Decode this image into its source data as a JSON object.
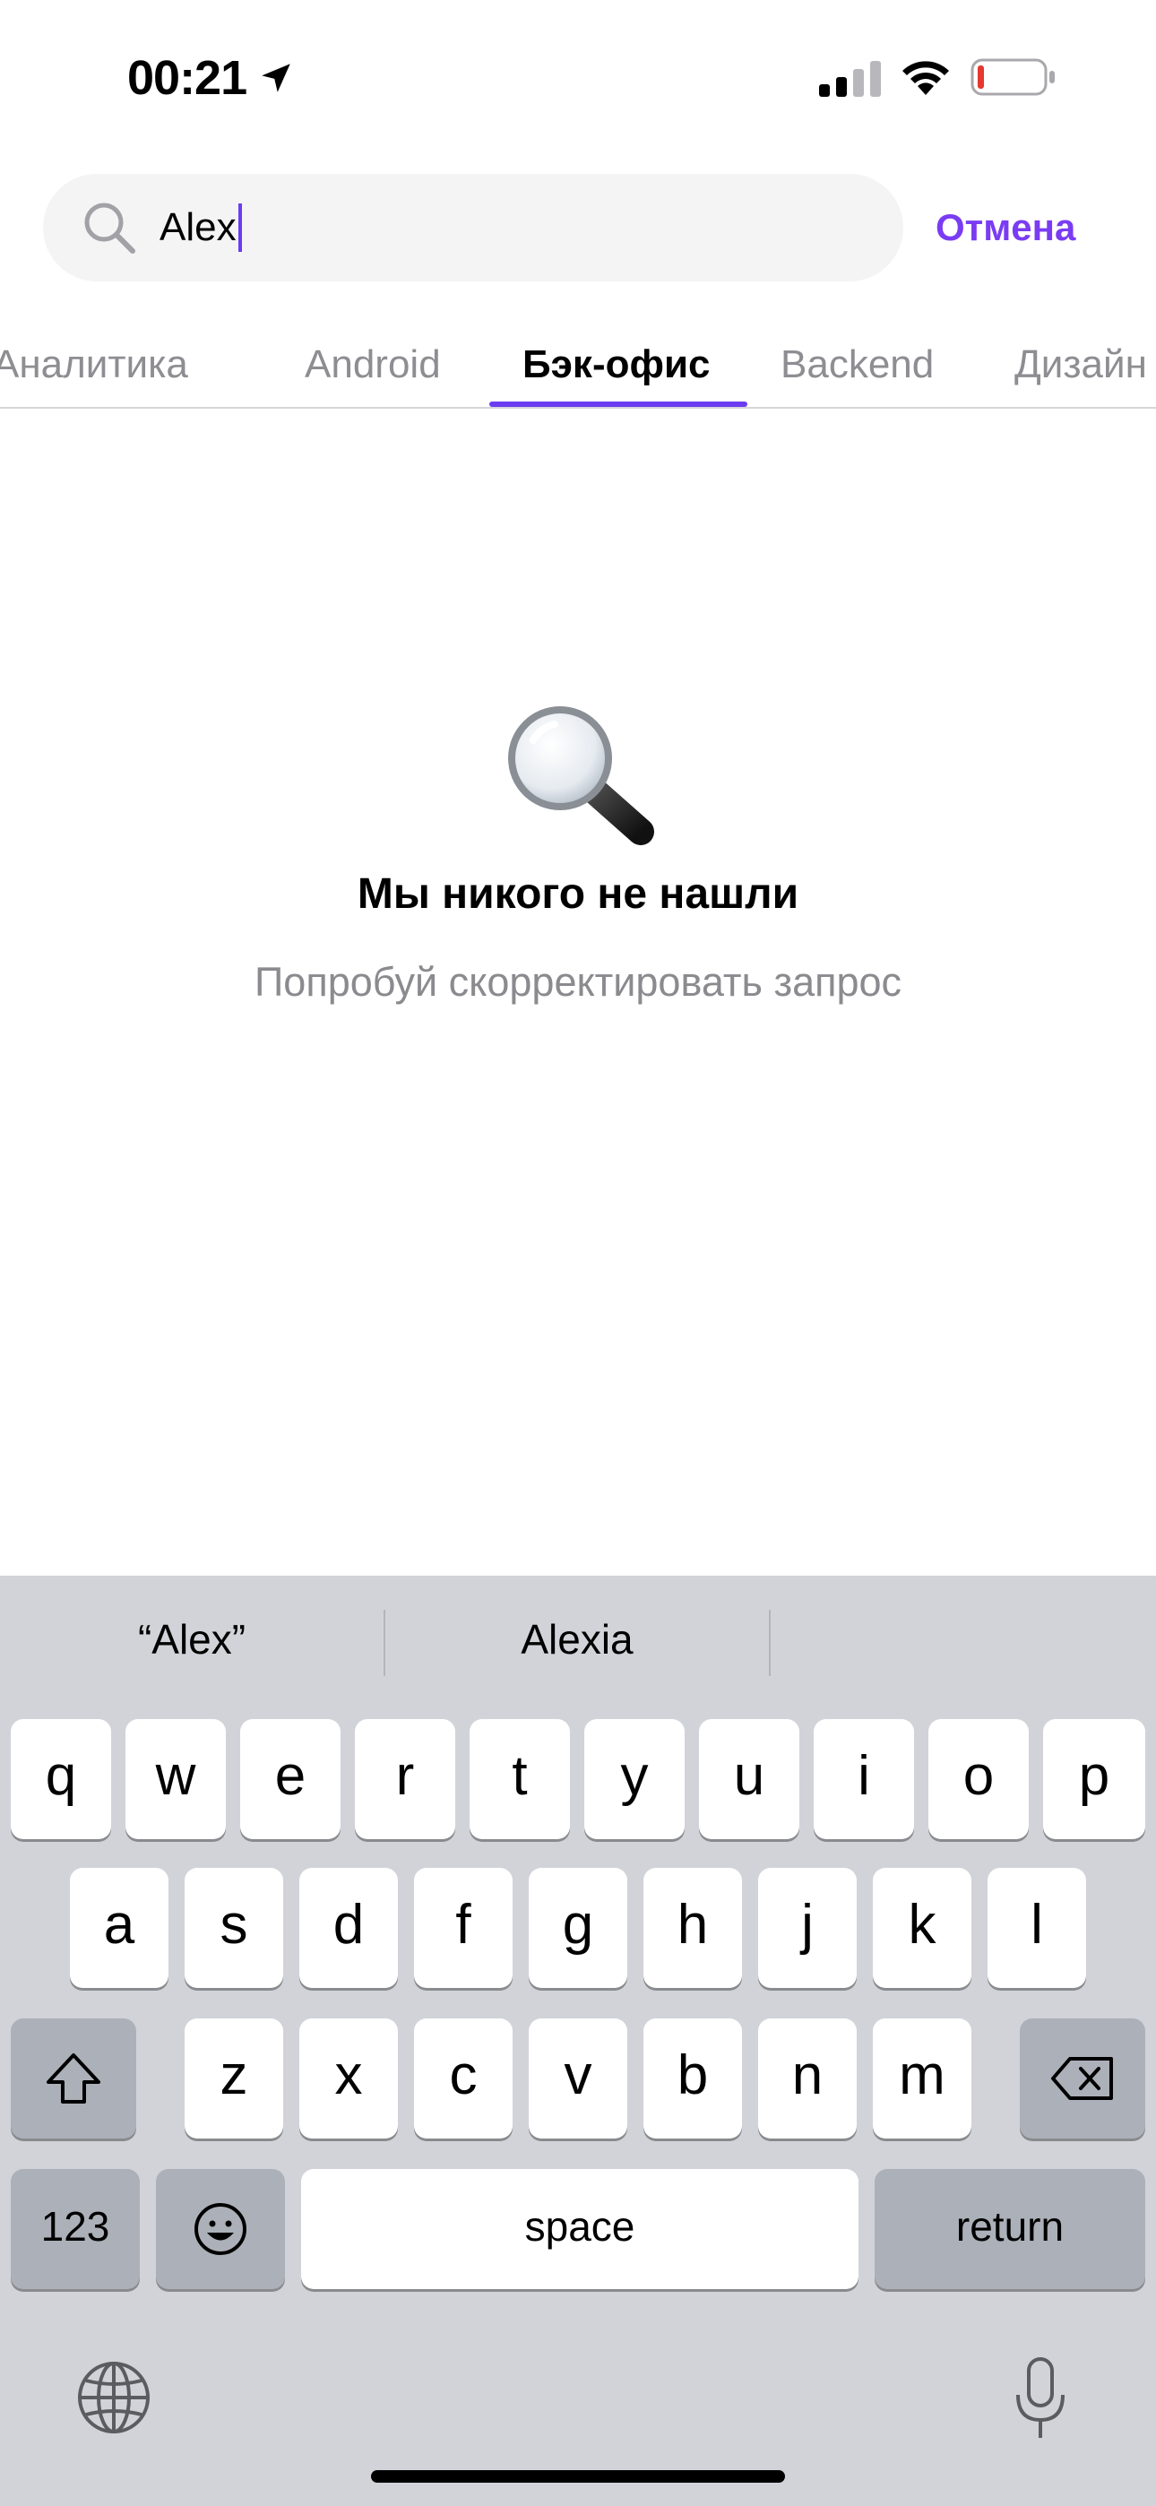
{
  "status_bar": {
    "time": "00:21",
    "battery_level": 0.08,
    "battery_color": "#e5392f"
  },
  "search": {
    "value": "Alex",
    "cancel_label": "Отмена"
  },
  "tabs": {
    "items": [
      "Аналитика",
      "Android",
      "Бэк-офис",
      "Backend",
      "Дизайн"
    ],
    "active_index": 2,
    "accent_color": "#6b3cf0"
  },
  "empty_state": {
    "icon": "magnifier-emoji",
    "title": "Мы никого не нашли",
    "subtitle": "Попробуй скорректировать запрос"
  },
  "keyboard": {
    "suggestions": [
      "“Alex”",
      "Alexia"
    ],
    "row1": [
      "q",
      "w",
      "e",
      "r",
      "t",
      "y",
      "u",
      "i",
      "o",
      "p"
    ],
    "row2": [
      "a",
      "s",
      "d",
      "f",
      "g",
      "h",
      "j",
      "k",
      "l"
    ],
    "row3": [
      "z",
      "x",
      "c",
      "v",
      "b",
      "n",
      "m"
    ],
    "numbers_label": "123",
    "space_label": "space",
    "return_label": "return"
  }
}
